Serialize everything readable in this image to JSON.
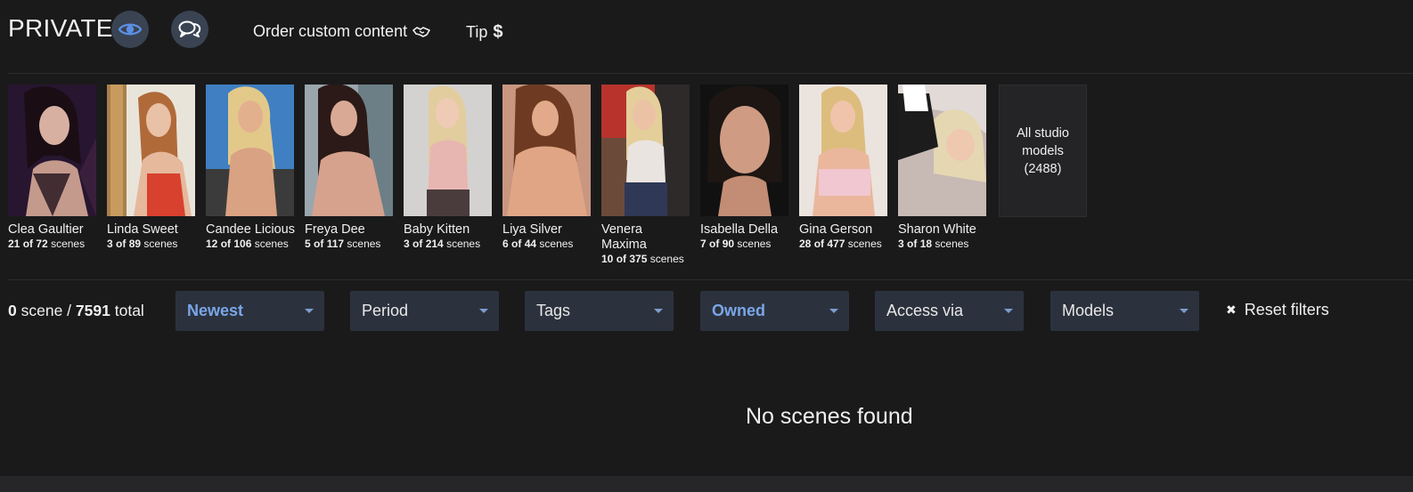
{
  "header": {
    "studio_title": "PRIVATE",
    "eye_icon": "eye-icon",
    "chat_icon": "chat-bubbles-icon",
    "order_label": "Order custom content",
    "order_icon": "handshake-icon",
    "tip_label": "Tip",
    "tip_icon": "dollar-icon"
  },
  "models": [
    {
      "name": "Clea Gaultier",
      "owned": "21",
      "total": "72",
      "scenes_word": "scenes"
    },
    {
      "name": "Linda Sweet",
      "owned": "3",
      "total": "89",
      "scenes_word": "scenes"
    },
    {
      "name": "Candee Licious",
      "owned": "12",
      "total": "106",
      "scenes_word": "scenes"
    },
    {
      "name": "Freya Dee",
      "owned": "5",
      "total": "117",
      "scenes_word": "scenes"
    },
    {
      "name": "Baby Kitten",
      "owned": "3",
      "total": "214",
      "scenes_word": "scenes"
    },
    {
      "name": "Liya Silver",
      "owned": "6",
      "total": "44",
      "scenes_word": "scenes"
    },
    {
      "name": "Venera Maxima",
      "owned": "10",
      "total": "375",
      "scenes_word": "scenes"
    },
    {
      "name": "Isabella Della",
      "owned": "7",
      "total": "90",
      "scenes_word": "scenes"
    },
    {
      "name": "Gina Gerson",
      "owned": "28",
      "total": "477",
      "scenes_word": "scenes"
    },
    {
      "name": "Sharon White",
      "owned": "3",
      "total": "18",
      "scenes_word": "scenes"
    }
  ],
  "all_models": {
    "label": "All studio models",
    "count": "(2488)"
  },
  "filters": {
    "scene_count": "0",
    "scene_word": "scene /",
    "total_count": "7591",
    "total_word": "total",
    "sort": "Newest",
    "period": "Period",
    "tags": "Tags",
    "ownership": "Owned",
    "access": "Access via",
    "models": "Models",
    "reset_label": "Reset filters"
  },
  "empty_message": "No scenes found",
  "colors": {
    "background": "#1a1a1b",
    "dropdown_bg": "#2c323d",
    "accent_blue": "#79a6e8",
    "icon_button_bg": "#3a4352"
  }
}
